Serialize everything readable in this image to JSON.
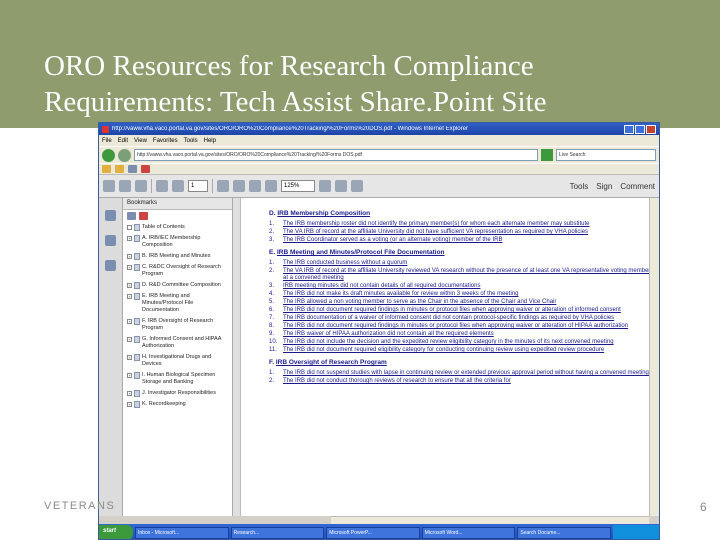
{
  "slide": {
    "title": "ORO Resources for Research Compliance Requirements: Tech Assist Share.Point Site",
    "footer": "VETERANS",
    "page_number": "6",
    "accent_color": "#8f9c6e"
  },
  "window": {
    "title": "http://vaww.vha.vaco.portal.va.gov/sites/ORO/ORO%20Compliance%20Tracking/%20Forms%20DOS.pdf - Windows Internet Explorer",
    "address": "http://vaww.vha.vaco.portal.va.gov/sites/ORO/ORO%20Compliance%20Tracking/%20Forms DOS.pdf",
    "search_placeholder": "Live Search",
    "menu": [
      "File",
      "Edit",
      "View",
      "Favorites",
      "Tools",
      "Help"
    ]
  },
  "toolbar": {
    "page_field": "1",
    "zoom": "125%",
    "tools_label": "Tools",
    "sign_label": "Sign",
    "comment_label": "Comment"
  },
  "sidebar": {
    "header": "Bookmarks",
    "items": [
      {
        "label": "Table of Contents"
      },
      {
        "label": "A. IRB/IEC Membership Composition"
      },
      {
        "label": "B. IRB Meeting and Minutes"
      },
      {
        "label": "C. R&DC Oversight of Research Program"
      },
      {
        "label": "D. R&D Committee Composition"
      },
      {
        "label": "E. IRB Meeting and Minutes/Protocol File Documentation"
      },
      {
        "label": "F. IRB Oversight of Research Program"
      },
      {
        "label": "G. Informed Consent and HIPAA Authorization"
      },
      {
        "label": "H. Investigational Drugs and Devices"
      },
      {
        "label": "I. Human Biological Specimen Storage and Banking"
      },
      {
        "label": "J. Investigator Responsibilities"
      },
      {
        "label": "K. Recordkeeping"
      }
    ]
  },
  "document": {
    "sections": [
      {
        "letter": "D.",
        "heading": "IRB Membership Composition",
        "items": [
          {
            "num": "1.",
            "text": "The IRB membership roster did not identify the primary member(s) for whom each alternate member may substitute"
          },
          {
            "num": "2.",
            "text": "The VA IRB of record at the affiliate University did not have sufficient VA representation as required by VHA policies"
          },
          {
            "num": "3.",
            "text": "The IRB Coordinator served as a voting (or an alternate voting) member of the IRB"
          }
        ]
      },
      {
        "letter": "E.",
        "heading": "IRB Meeting and Minutes/Protocol File Documentation",
        "items": [
          {
            "num": "1.",
            "text": "The IRB conducted business without a quorum"
          },
          {
            "num": "2.",
            "text": "The VA IRB of record at the affiliate University reviewed VA research without the presence of at least one VA representative voting member at a convened meeting"
          },
          {
            "num": "3.",
            "text": "IRB meeting minutes did not contain details of all required documentations"
          },
          {
            "num": "4.",
            "text": "The IRB did not make its draft minutes available for review within 3 weeks of the meeting"
          },
          {
            "num": "5.",
            "text": "The IRB allowed a non voting member to serve as the Chair in the absence of the Chair and Vice Chair"
          },
          {
            "num": "6.",
            "text": "The IRB did not document required findings in minutes or protocol files when approving waiver or alteration of informed consent"
          },
          {
            "num": "7.",
            "text": "The IRB documentation of a waiver of informed consent did not contain protocol-specific findings as required by VHA policies"
          },
          {
            "num": "8.",
            "text": "The IRB did not document required findings in minutes or protocol files when approving waiver or alteration of HIPAA authorization"
          },
          {
            "num": "9.",
            "text": "The IRB waiver of HIPAA authorization did not contain all the required elements"
          },
          {
            "num": "10.",
            "text": "The IRB did not include the decision and the expedited review eligibility category in the minutes of its next convened meeting"
          },
          {
            "num": "11.",
            "text": "The IRB did not document required eligibility category for conducting continuing review using expedited review procedure"
          }
        ]
      },
      {
        "letter": "F.",
        "heading": "IRB Oversight of Research Program",
        "items": [
          {
            "num": "1.",
            "text": "The IRB did not suspend studies with lapse in continuing review or extended previous approval period without having a convened meeting"
          },
          {
            "num": "2.",
            "text": "The IRB did not conduct thorough reviews of research to ensure that all the criteria for"
          }
        ]
      }
    ]
  },
  "taskbar": {
    "start_label": "start",
    "items": [
      "Inbox - Microsoft...",
      "Research...",
      "Microsoft PowerP...",
      "Microsoft Word...",
      "Search Docume..."
    ]
  }
}
